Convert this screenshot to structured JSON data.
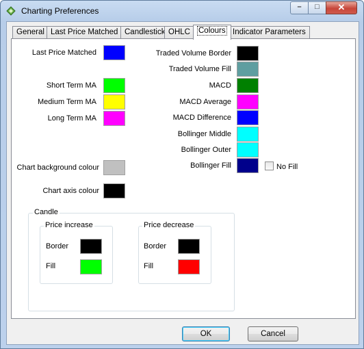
{
  "window": {
    "title": "Charting Preferences",
    "controls": {
      "minimize": "–",
      "maximize": "□",
      "close": "✕"
    }
  },
  "tabs": [
    {
      "label": "General"
    },
    {
      "label": "Last Price Matched"
    },
    {
      "label": "Candlestick"
    },
    {
      "label": "OHLC"
    },
    {
      "label": "Colours"
    },
    {
      "label": "Indicator Parameters"
    }
  ],
  "active_tab": "Colours",
  "left_colours": [
    {
      "label": "Last Price Matched",
      "color": "#0000ff"
    },
    {
      "label": "Short Term MA",
      "color": "#00ff00"
    },
    {
      "label": "Medium Term MA",
      "color": "#ffff00"
    },
    {
      "label": "Long Term MA",
      "color": "#ff00ff"
    },
    {
      "label": "Chart background colour",
      "color": "#c0c0c0"
    },
    {
      "label": "Chart axis colour",
      "color": "#000000"
    }
  ],
  "right_colours": [
    {
      "label": "Traded Volume Border",
      "color": "#000000"
    },
    {
      "label": "Traded Volume Fill",
      "color": "#5f9ea0"
    },
    {
      "label": "MACD",
      "color": "#008000"
    },
    {
      "label": "MACD Average",
      "color": "#ff00ff"
    },
    {
      "label": "MACD Difference",
      "color": "#0000ff"
    },
    {
      "label": "Bollinger Middle",
      "color": "#00ffff"
    },
    {
      "label": "Bollinger Outer",
      "color": "#00ffff"
    },
    {
      "label": "Bollinger Fill",
      "color": "#00008b"
    }
  ],
  "no_fill": {
    "label": "No Fill",
    "checked": false
  },
  "candle": {
    "title": "Candle",
    "increase": {
      "title": "Price increase",
      "border_label": "Border",
      "border_color": "#000000",
      "fill_label": "Fill",
      "fill_color": "#00ff00"
    },
    "decrease": {
      "title": "Price decrease",
      "border_label": "Border",
      "border_color": "#000000",
      "fill_label": "Fill",
      "fill_color": "#ff0000"
    }
  },
  "buttons": {
    "ok": "OK",
    "cancel": "Cancel"
  }
}
